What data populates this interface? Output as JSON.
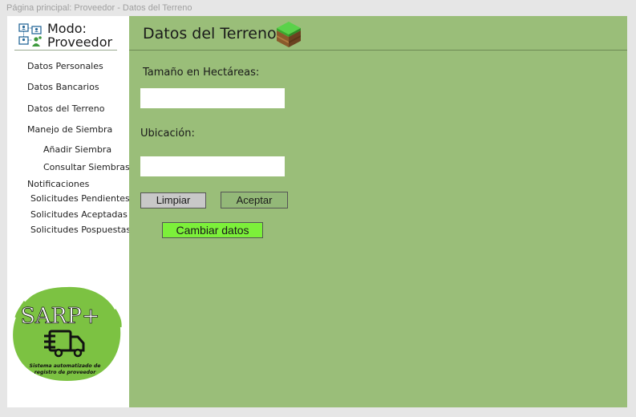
{
  "window": {
    "title": "Página principal: Proveedor - Datos del Terreno"
  },
  "sidebar": {
    "brand": {
      "line1": "Modo:",
      "line2": "Proveedor",
      "icon": "network-users-icon"
    },
    "items": [
      {
        "label": "Datos Personales"
      },
      {
        "label": "Datos Bancarios"
      },
      {
        "label": "Datos del Terreno"
      },
      {
        "label": "Manejo de Siembra"
      },
      {
        "label": "Añadir Siembra"
      },
      {
        "label": "Consultar Siembras"
      },
      {
        "label": "Notificaciones"
      },
      {
        "label": "Solicitudes Pendientes"
      },
      {
        "label": "Solicitudes Aceptadas"
      },
      {
        "label": "Solicitudes Pospuestas"
      }
    ],
    "logo": {
      "name": "SARP+",
      "tagline_1": "Sistema automatizado de",
      "tagline_2": "registro de proveedor",
      "color": "#7cc242"
    }
  },
  "main": {
    "title": "Datos del Terreno",
    "title_icon": "grass-block-icon",
    "form": {
      "size_label": "Tamaño en Hectáreas:",
      "size_value": "",
      "location_label": "Ubicación:",
      "location_value": ""
    },
    "buttons": {
      "clear": "Limpiar",
      "accept": "Aceptar",
      "change": "Cambiar datos"
    },
    "colors": {
      "background": "#9abe79",
      "accent_button": "#7cf03a"
    }
  }
}
